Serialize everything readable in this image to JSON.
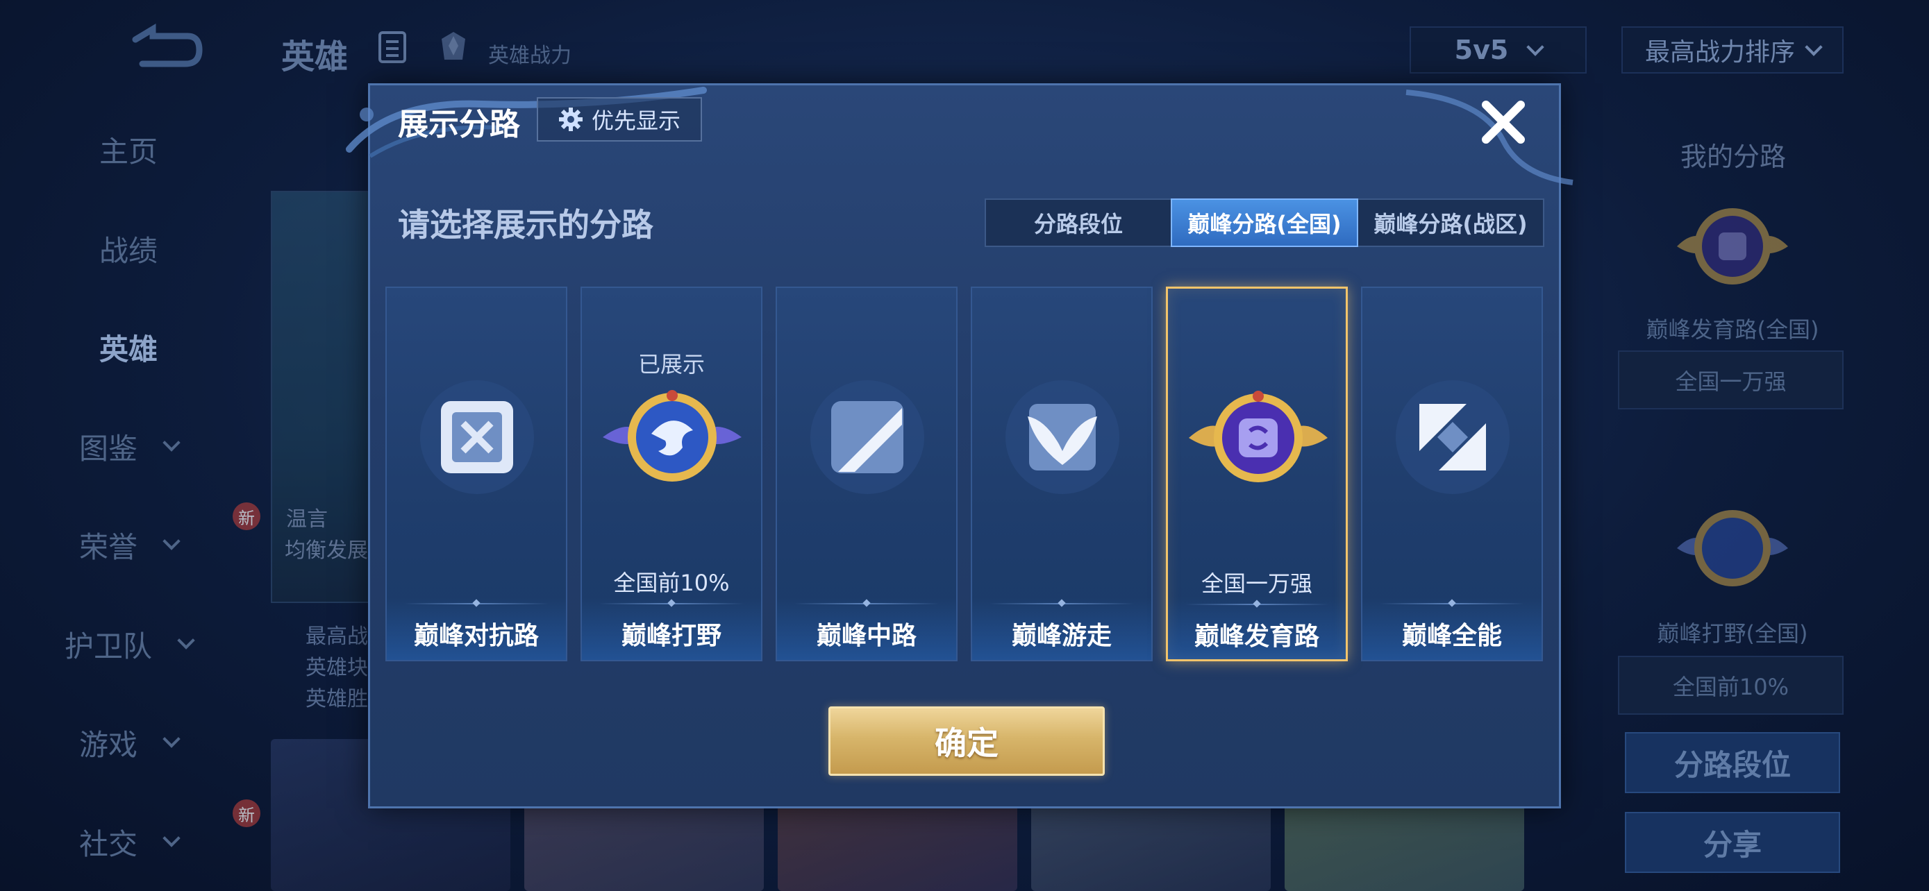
{
  "header": {
    "title": "英雄",
    "power_label": "英雄战力",
    "mode_select": "5v5",
    "sort_select": "最高战力排序"
  },
  "sidebar": {
    "items": [
      {
        "label": "主页"
      },
      {
        "label": "战绩"
      },
      {
        "label": "英雄"
      },
      {
        "label": "图鉴"
      },
      {
        "label": "荣誉",
        "badge": "新"
      },
      {
        "label": "护卫队"
      },
      {
        "label": "游戏"
      },
      {
        "label": "社交",
        "badge": "新"
      }
    ]
  },
  "hero_card": {
    "name": "温言",
    "role": "均衡发展"
  },
  "hero_stats": [
    "最高战",
    "英雄块",
    "英雄胜"
  ],
  "right_panel": {
    "title": "我的分路",
    "lane1_name": "巅峰发育路(全国)",
    "lane1_rank": "全国一万强",
    "lane2_name": "巅峰打野(全国)",
    "lane2_rank": "全国前10%",
    "lane_rank_button": "分路段位",
    "share_button": "分享"
  },
  "modal": {
    "title": "展示分路",
    "priority_button": "优先显示",
    "subtitle": "请选择展示的分路",
    "tabs": [
      "分路段位",
      "巅峰分路(全国)",
      "巅峰分路(战区)"
    ],
    "active_tab": "巅峰分路(全国)",
    "lanes": [
      {
        "name": "巅峰对抗路",
        "status": "",
        "rank": ""
      },
      {
        "name": "巅峰打野",
        "status": "已展示",
        "rank": "全国前10%"
      },
      {
        "name": "巅峰中路",
        "status": "",
        "rank": ""
      },
      {
        "name": "巅峰游走",
        "status": "",
        "rank": ""
      },
      {
        "name": "巅峰发育路",
        "status": "",
        "rank": "全国一万强"
      },
      {
        "name": "巅峰全能",
        "status": "",
        "rank": ""
      }
    ],
    "selected_lane": "巅峰发育路",
    "confirm_button": "确定"
  },
  "colors": {
    "accent_blue": "#3f82d8",
    "gold": "#d7b56a",
    "selected_border": "#f2c46b"
  }
}
